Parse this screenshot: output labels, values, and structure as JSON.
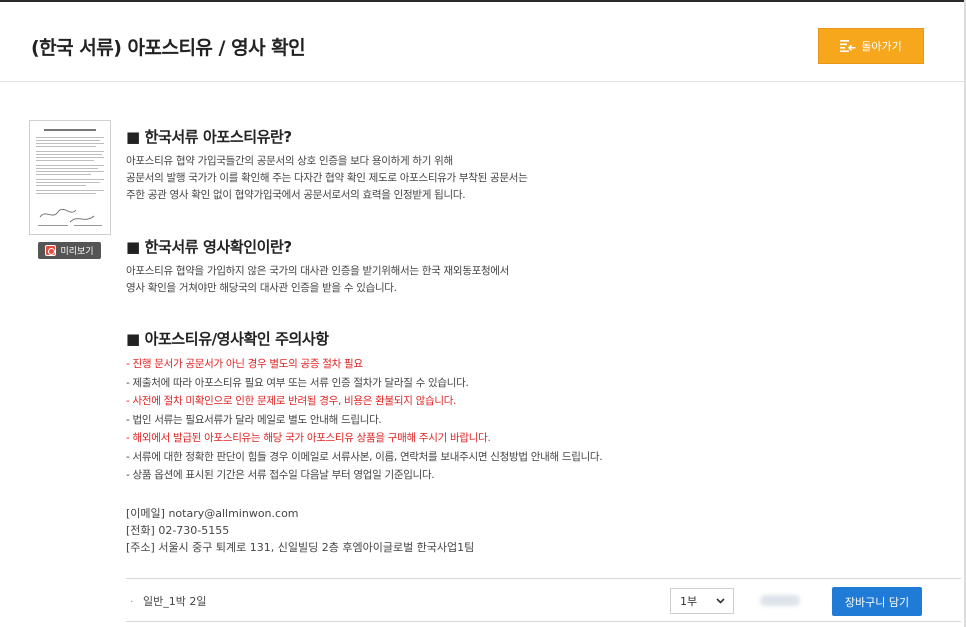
{
  "header": {
    "title": "(한국 서류) 아포스티유 / 영사 확인",
    "back_label": "돌아가기"
  },
  "preview": {
    "label": "미리보기"
  },
  "sections": {
    "apostille": {
      "heading": "■ 한국서류 아포스티유란?",
      "lines": [
        "아포스티유 협약 가입국들간의 공문서의 상호 인증을 보다 용이하게 하기 위해",
        "공문서의 발행 국가가 이를 확인해 주는 다자간 협약 확인 제도로 아포스티유가 부착된 공문서는",
        "주한 공관 영사 확인 없이 협약가입국에서 공문서로서의 효력을 인정받게 됩니다."
      ]
    },
    "consular": {
      "heading": "■ 한국서류 영사확인이란?",
      "lines": [
        "아포스티유 협약을 가입하지 않은 국가의 대사관 인증을 받기위해서는 한국 재외동포청에서",
        "영사 확인을 거쳐야만 해당국의 대사관 인증을 받을 수 있습니다."
      ]
    },
    "notes": {
      "heading": "■ 아포스티유/영사확인 주의사항",
      "lines": [
        "- 진행 문서가 공문서가 아닌 경우 별도의 공증 절차 필요",
        "- 제출처에 따라 아포스티유 필요 여부 또는 서류 인증 절차가 달라질 수 있습니다.",
        "- 사전에 절차 미확인으로 인한 문제로 반려될 경우, 비용은 환불되지 않습니다.",
        "- 법인 서류는 필요서류가 달라 메일로 별도 안내해 드립니다.",
        "- 해외에서 발급된 아포스티유는 해당 국가 아포스티유 상품을 구매해 주시기 바랍니다.",
        "- 서류에 대한 정확한 판단이 힘들 경우 이메일로 서류사본, 이름, 연락처를 보내주시면 신청방법 안내해 드립니다.",
        "- 상품 옵션에 표시된 기간은 서류 접수일 다음날 부터 영업일 기준입니다."
      ]
    }
  },
  "contact": {
    "email": "[이메일] notary@allminwon.com",
    "phone": "[전화] 02-730-5155",
    "address": "[주소] 서울시 중구 퇴계로 131, 신일빌딩 2층 후엠아이글로벌 한국사업1팀"
  },
  "product": {
    "bullet": "·",
    "name": "일반_1박 2일",
    "quantity_selected": "1부",
    "cart_label": "장바구니 담기"
  },
  "colors": {
    "accent_orange": "#f7a71c",
    "cart_blue": "#1f7bd6",
    "warning_red": "#e02424"
  }
}
